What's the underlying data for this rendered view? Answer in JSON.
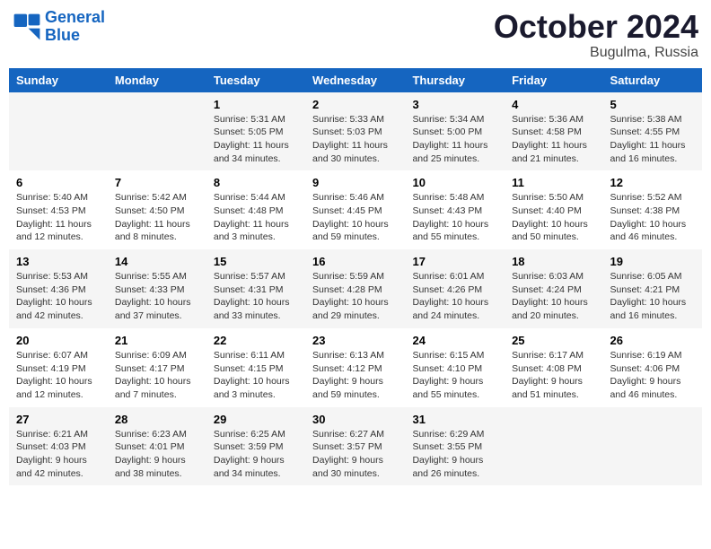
{
  "header": {
    "logo_line1": "General",
    "logo_line2": "Blue",
    "month": "October 2024",
    "location": "Bugulma, Russia"
  },
  "weekdays": [
    "Sunday",
    "Monday",
    "Tuesday",
    "Wednesday",
    "Thursday",
    "Friday",
    "Saturday"
  ],
  "weeks": [
    [
      {
        "day": "",
        "info": ""
      },
      {
        "day": "",
        "info": ""
      },
      {
        "day": "1",
        "info": "Sunrise: 5:31 AM\nSunset: 5:05 PM\nDaylight: 11 hours and 34 minutes."
      },
      {
        "day": "2",
        "info": "Sunrise: 5:33 AM\nSunset: 5:03 PM\nDaylight: 11 hours and 30 minutes."
      },
      {
        "day": "3",
        "info": "Sunrise: 5:34 AM\nSunset: 5:00 PM\nDaylight: 11 hours and 25 minutes."
      },
      {
        "day": "4",
        "info": "Sunrise: 5:36 AM\nSunset: 4:58 PM\nDaylight: 11 hours and 21 minutes."
      },
      {
        "day": "5",
        "info": "Sunrise: 5:38 AM\nSunset: 4:55 PM\nDaylight: 11 hours and 16 minutes."
      }
    ],
    [
      {
        "day": "6",
        "info": "Sunrise: 5:40 AM\nSunset: 4:53 PM\nDaylight: 11 hours and 12 minutes."
      },
      {
        "day": "7",
        "info": "Sunrise: 5:42 AM\nSunset: 4:50 PM\nDaylight: 11 hours and 8 minutes."
      },
      {
        "day": "8",
        "info": "Sunrise: 5:44 AM\nSunset: 4:48 PM\nDaylight: 11 hours and 3 minutes."
      },
      {
        "day": "9",
        "info": "Sunrise: 5:46 AM\nSunset: 4:45 PM\nDaylight: 10 hours and 59 minutes."
      },
      {
        "day": "10",
        "info": "Sunrise: 5:48 AM\nSunset: 4:43 PM\nDaylight: 10 hours and 55 minutes."
      },
      {
        "day": "11",
        "info": "Sunrise: 5:50 AM\nSunset: 4:40 PM\nDaylight: 10 hours and 50 minutes."
      },
      {
        "day": "12",
        "info": "Sunrise: 5:52 AM\nSunset: 4:38 PM\nDaylight: 10 hours and 46 minutes."
      }
    ],
    [
      {
        "day": "13",
        "info": "Sunrise: 5:53 AM\nSunset: 4:36 PM\nDaylight: 10 hours and 42 minutes."
      },
      {
        "day": "14",
        "info": "Sunrise: 5:55 AM\nSunset: 4:33 PM\nDaylight: 10 hours and 37 minutes."
      },
      {
        "day": "15",
        "info": "Sunrise: 5:57 AM\nSunset: 4:31 PM\nDaylight: 10 hours and 33 minutes."
      },
      {
        "day": "16",
        "info": "Sunrise: 5:59 AM\nSunset: 4:28 PM\nDaylight: 10 hours and 29 minutes."
      },
      {
        "day": "17",
        "info": "Sunrise: 6:01 AM\nSunset: 4:26 PM\nDaylight: 10 hours and 24 minutes."
      },
      {
        "day": "18",
        "info": "Sunrise: 6:03 AM\nSunset: 4:24 PM\nDaylight: 10 hours and 20 minutes."
      },
      {
        "day": "19",
        "info": "Sunrise: 6:05 AM\nSunset: 4:21 PM\nDaylight: 10 hours and 16 minutes."
      }
    ],
    [
      {
        "day": "20",
        "info": "Sunrise: 6:07 AM\nSunset: 4:19 PM\nDaylight: 10 hours and 12 minutes."
      },
      {
        "day": "21",
        "info": "Sunrise: 6:09 AM\nSunset: 4:17 PM\nDaylight: 10 hours and 7 minutes."
      },
      {
        "day": "22",
        "info": "Sunrise: 6:11 AM\nSunset: 4:15 PM\nDaylight: 10 hours and 3 minutes."
      },
      {
        "day": "23",
        "info": "Sunrise: 6:13 AM\nSunset: 4:12 PM\nDaylight: 9 hours and 59 minutes."
      },
      {
        "day": "24",
        "info": "Sunrise: 6:15 AM\nSunset: 4:10 PM\nDaylight: 9 hours and 55 minutes."
      },
      {
        "day": "25",
        "info": "Sunrise: 6:17 AM\nSunset: 4:08 PM\nDaylight: 9 hours and 51 minutes."
      },
      {
        "day": "26",
        "info": "Sunrise: 6:19 AM\nSunset: 4:06 PM\nDaylight: 9 hours and 46 minutes."
      }
    ],
    [
      {
        "day": "27",
        "info": "Sunrise: 6:21 AM\nSunset: 4:03 PM\nDaylight: 9 hours and 42 minutes."
      },
      {
        "day": "28",
        "info": "Sunrise: 6:23 AM\nSunset: 4:01 PM\nDaylight: 9 hours and 38 minutes."
      },
      {
        "day": "29",
        "info": "Sunrise: 6:25 AM\nSunset: 3:59 PM\nDaylight: 9 hours and 34 minutes."
      },
      {
        "day": "30",
        "info": "Sunrise: 6:27 AM\nSunset: 3:57 PM\nDaylight: 9 hours and 30 minutes."
      },
      {
        "day": "31",
        "info": "Sunrise: 6:29 AM\nSunset: 3:55 PM\nDaylight: 9 hours and 26 minutes."
      },
      {
        "day": "",
        "info": ""
      },
      {
        "day": "",
        "info": ""
      }
    ]
  ]
}
